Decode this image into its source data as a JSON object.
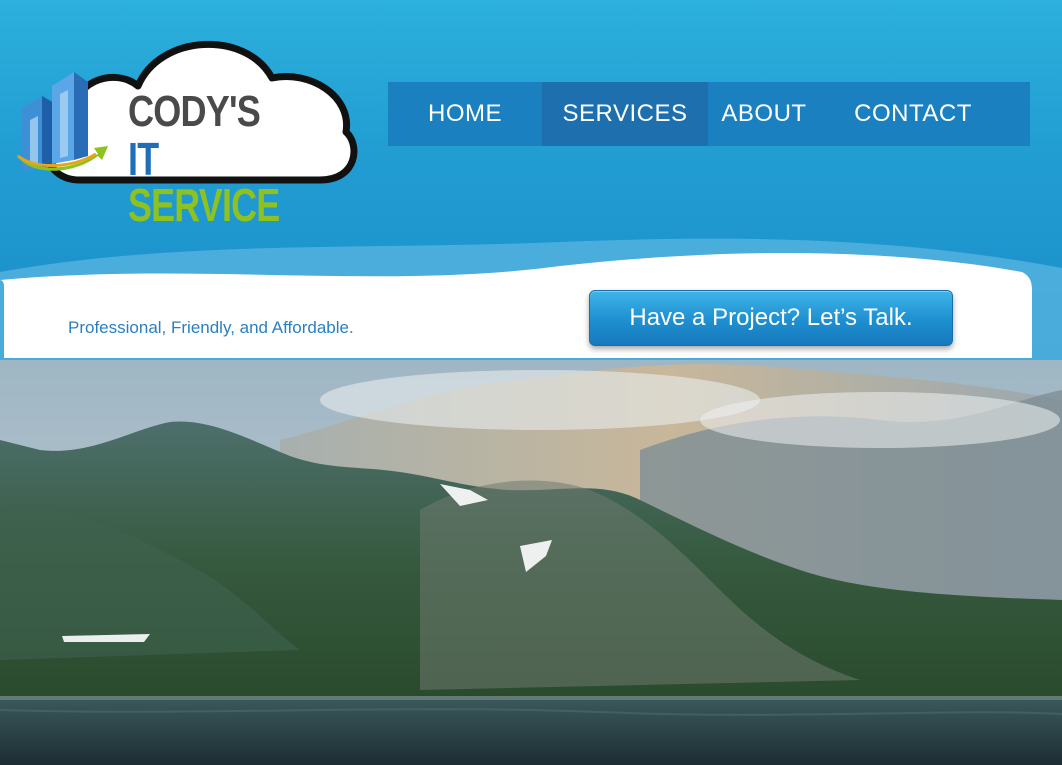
{
  "logo": {
    "line1": "CODY'S",
    "line2_a": "IT",
    "line2_b": "SERVICE",
    "icon": "buildings-cloud-logo-icon"
  },
  "nav": {
    "items": [
      {
        "label": "HOME"
      },
      {
        "label": "SERVICES",
        "active": true
      },
      {
        "label": "ABOUT"
      },
      {
        "label": "CONTACT"
      }
    ]
  },
  "banner": {
    "tagline": "Professional, Friendly, and Affordable.",
    "cta_label": "Have a Project? Let’s Talk."
  },
  "hero": {
    "image": "mountain-lake-landscape"
  },
  "colors": {
    "header_bg": "#229ed3",
    "nav_bg": "#1b80bf",
    "nav_active_bg": "#1d6fae",
    "tagline": "#2b7fc0",
    "logo_gray": "#4a4a4a",
    "logo_blue": "#1f6fb8",
    "logo_green": "#8dc21f"
  }
}
